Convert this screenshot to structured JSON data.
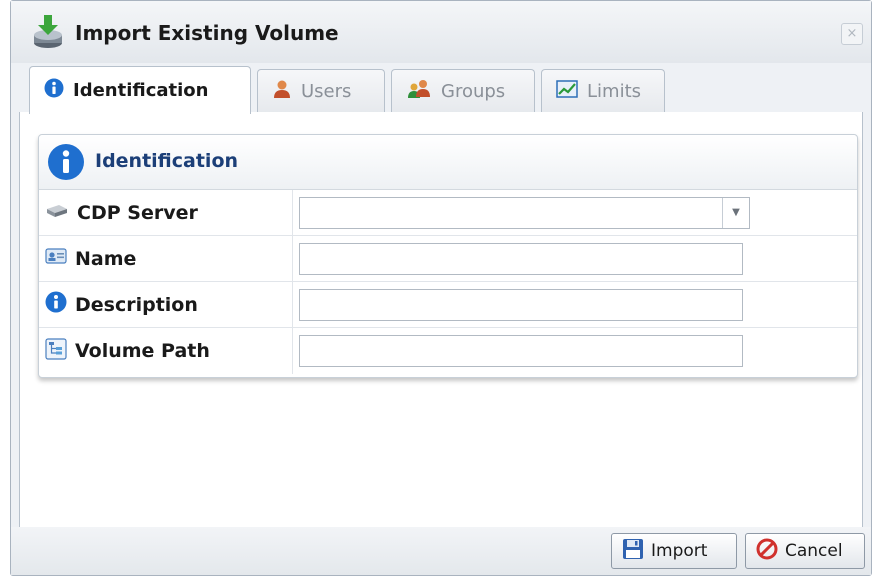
{
  "window": {
    "title": "Import Existing Volume",
    "close_label": "×"
  },
  "tabs": [
    {
      "label": "Identification",
      "icon": "info-icon",
      "active": true
    },
    {
      "label": "Users",
      "icon": "user-icon",
      "active": false
    },
    {
      "label": "Groups",
      "icon": "group-icon",
      "active": false
    },
    {
      "label": "Limits",
      "icon": "chart-icon",
      "active": false
    }
  ],
  "panel": {
    "title": "Identification",
    "fields": [
      {
        "label": "CDP Server",
        "type": "select",
        "value": "",
        "icon": "server-icon"
      },
      {
        "label": "Name",
        "type": "text",
        "value": "",
        "icon": "name-card-icon"
      },
      {
        "label": "Description",
        "type": "text",
        "value": "",
        "icon": "info-icon"
      },
      {
        "label": "Volume Path",
        "type": "text",
        "value": "",
        "icon": "tree-path-icon"
      }
    ]
  },
  "footer": {
    "import_label": "Import",
    "cancel_label": "Cancel"
  },
  "colors": {
    "header_text": "#1c3f78",
    "info_blue": "#1f6fcf",
    "cancel_red": "#d0312d"
  }
}
